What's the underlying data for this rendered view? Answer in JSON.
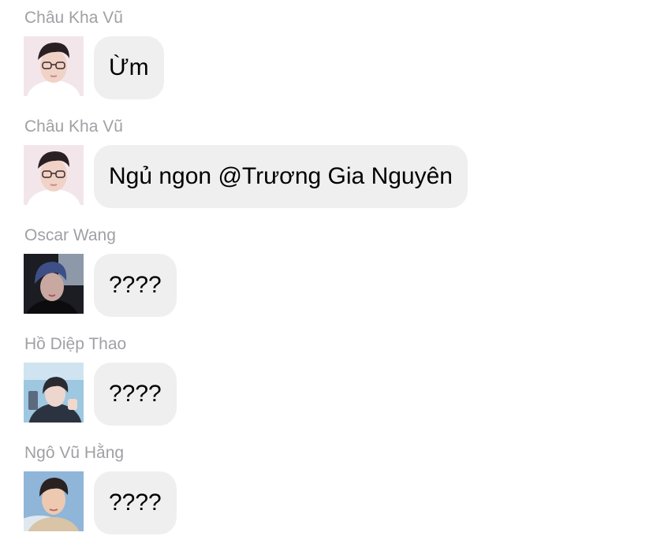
{
  "conversation": {
    "messages": [
      {
        "sender": "Châu Kha Vũ",
        "avatar": "avatar-chau-kha-vu",
        "text": "Ừm"
      },
      {
        "sender": "Châu Kha Vũ",
        "avatar": "avatar-chau-kha-vu",
        "text": "Ngủ ngon @Trương Gia Nguyên"
      },
      {
        "sender": "Oscar Wang",
        "avatar": "avatar-oscar-wang",
        "text": "????"
      },
      {
        "sender": "Hồ Diệp Thao",
        "avatar": "avatar-ho-diep-thao",
        "text": "????"
      },
      {
        "sender": "Ngô Vũ Hằng",
        "avatar": "avatar-ngo-vu-hang",
        "text": "????"
      }
    ]
  },
  "colors": {
    "sender_name": "#a0a0a5",
    "bubble_bg": "#efefef",
    "text": "#000000",
    "background": "#ffffff"
  }
}
